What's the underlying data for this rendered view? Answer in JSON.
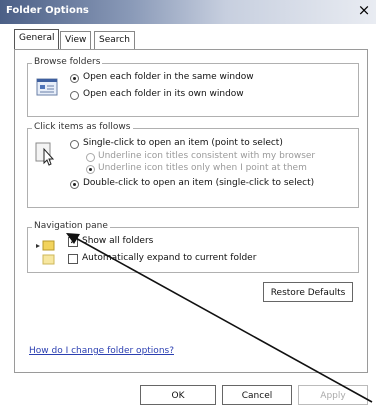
{
  "window": {
    "title": "Folder Options",
    "close_glyph": "×"
  },
  "tabs": [
    {
      "label": "General"
    },
    {
      "label": "View"
    },
    {
      "label": "Search"
    }
  ],
  "browse_folders": {
    "heading": "Browse folders",
    "options": [
      {
        "label": "Open each folder in the same window",
        "selected": true
      },
      {
        "label": "Open each folder in its own window",
        "selected": false
      }
    ]
  },
  "click_items": {
    "heading": "Click items as follows",
    "single": "Single-click to open an item (point to select)",
    "sub_options": [
      "Underline icon titles consistent with my browser",
      "Underline icon titles only when I point at them"
    ],
    "double": "Double-click to open an item (single-click to select)"
  },
  "navigation_pane": {
    "heading": "Navigation pane",
    "show_all": "Show all folders",
    "auto_expand": "Automatically expand to current folder"
  },
  "restore_defaults": "Restore Defaults",
  "help_link": "How do I change folder options?",
  "buttons": {
    "ok": "OK",
    "cancel": "Cancel",
    "apply": "Apply"
  }
}
